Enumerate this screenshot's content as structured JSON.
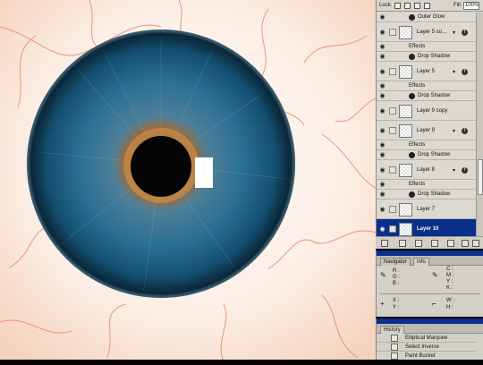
{
  "layers_panel": {
    "lock_label": "Lock:",
    "fill_label": "Fill:",
    "fill_value": "100%",
    "rows": [
      {
        "kind": "effect",
        "name": "Outer Glow"
      },
      {
        "kind": "layer",
        "name": "Layer 5 co...",
        "fx": true
      },
      {
        "kind": "effects_header",
        "name": "Effects"
      },
      {
        "kind": "effect",
        "name": "Drop Shadow"
      },
      {
        "kind": "layer",
        "name": "Layer 5",
        "fx": true
      },
      {
        "kind": "effects_header",
        "name": "Effects"
      },
      {
        "kind": "effect",
        "name": "Drop Shadow"
      },
      {
        "kind": "layer",
        "name": "Layer 9 copy",
        "fx": false
      },
      {
        "kind": "layer",
        "name": "Layer 9",
        "fx": true
      },
      {
        "kind": "effects_header",
        "name": "Effects"
      },
      {
        "kind": "effect",
        "name": "Drop Shadow"
      },
      {
        "kind": "layer",
        "name": "Layer 8",
        "fx": true
      },
      {
        "kind": "effects_header",
        "name": "Effects"
      },
      {
        "kind": "effect",
        "name": "Drop Shadow"
      },
      {
        "kind": "layer",
        "name": "Layer 7",
        "fx": false
      },
      {
        "kind": "layer",
        "name": "Layer 10",
        "fx": false,
        "selected": true
      }
    ]
  },
  "info_panel": {
    "tabs": [
      "Navigator",
      "Info"
    ],
    "active_tab": "Info",
    "r_label": "R :",
    "g_label": "G :",
    "b_label": "B :",
    "c_label": "C :",
    "m_label": "M :",
    "y_label": "Y :",
    "k_label": "K :",
    "x_label": "X :",
    "y2_label": "Y :",
    "w_label": "W :",
    "h_label": "H :"
  },
  "history_panel": {
    "title": "History",
    "items": [
      "Elliptical Marquee",
      "Select Inverse",
      "Paint Bucket"
    ]
  },
  "colors": {
    "selected_row": "#0a2f8a",
    "iris_blue": "#1e5f86",
    "iris_brown": "#8a5a2a",
    "vein": "#e27a55"
  }
}
